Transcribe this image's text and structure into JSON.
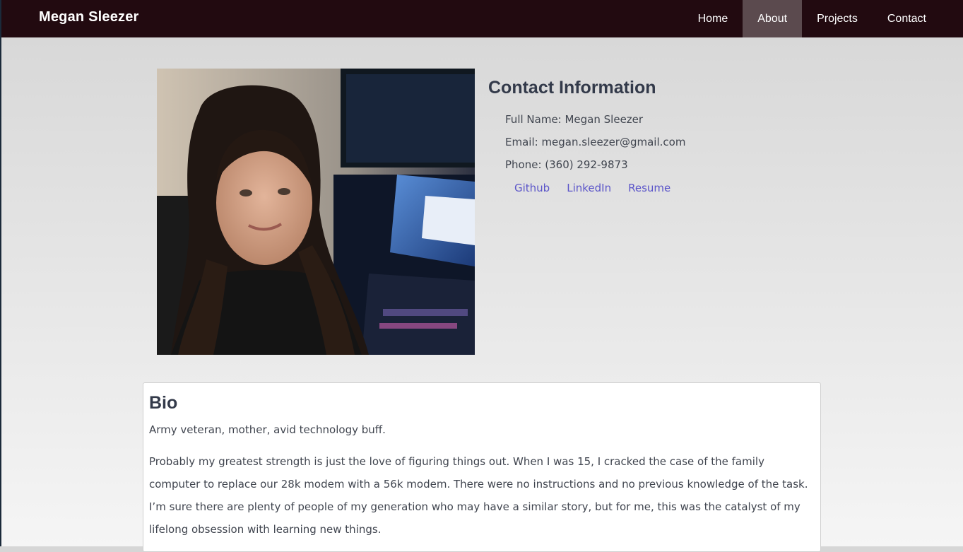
{
  "nav": {
    "brand": "Megan Sleezer",
    "items": [
      {
        "label": "Home",
        "active": false
      },
      {
        "label": "About",
        "active": true
      },
      {
        "label": "Projects",
        "active": false
      },
      {
        "label": "Contact",
        "active": false
      }
    ]
  },
  "contact": {
    "title": "Contact Information",
    "full_name": "Full Name: Megan Sleezer",
    "email": "Email: megan.sleezer@gmail.com",
    "phone": "Phone: (360) 292-9873",
    "links": [
      "Github",
      "LinkedIn",
      "Resume"
    ]
  },
  "bio": {
    "title": "Bio",
    "paragraphs": [
      "Army veteran, mother, avid technology buff.",
      "Probably my greatest strength is just the love of figuring things out. When I was 15, I cracked the case of the family computer to replace our 28k modem with a 56k modem. There were no instructions and no previous knowledge of the task. I’m sure there are plenty of people of my generation who may have a similar story, but for me, this was the catalyst of my lifelong obsession with learning new things."
    ]
  },
  "colors": {
    "navbar": "#220a10",
    "nav_active": "#5b4a4e",
    "link": "#5b55c9",
    "heading": "#333a4a"
  }
}
